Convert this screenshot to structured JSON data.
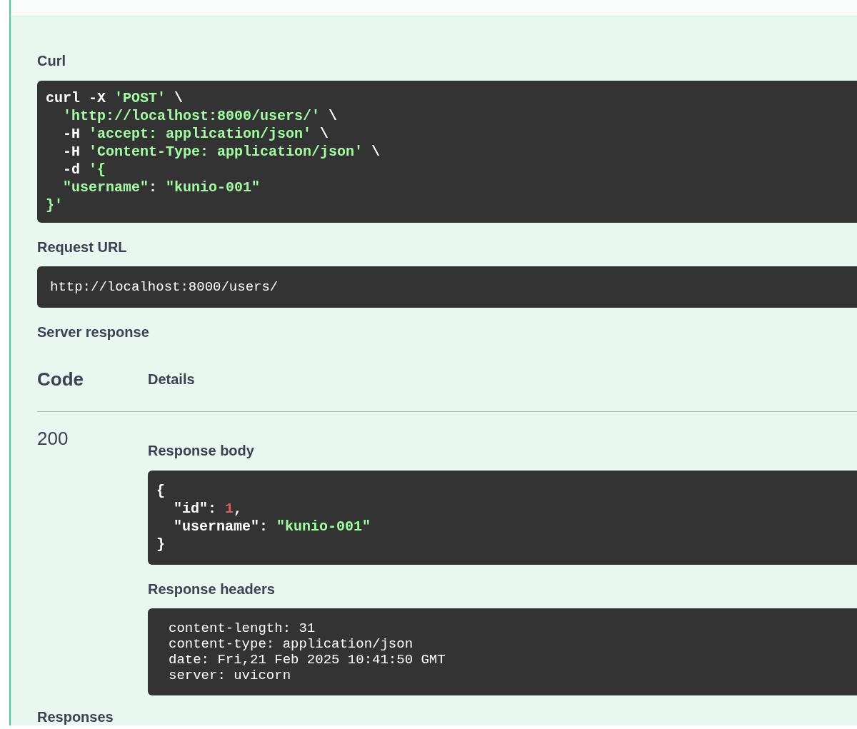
{
  "curl": {
    "label": "Curl",
    "lines": [
      [
        {
          "kind": "plain",
          "text": "curl -X "
        },
        {
          "kind": "string",
          "text": "'POST'"
        },
        {
          "kind": "plain",
          "text": " \\"
        }
      ],
      [
        {
          "kind": "string",
          "text": "  'http://localhost:8000/users/'"
        },
        {
          "kind": "plain",
          "text": " \\"
        }
      ],
      [
        {
          "kind": "plain",
          "text": "  -H "
        },
        {
          "kind": "string",
          "text": "'accept: application/json'"
        },
        {
          "kind": "plain",
          "text": " \\"
        }
      ],
      [
        {
          "kind": "plain",
          "text": "  -H "
        },
        {
          "kind": "string",
          "text": "'Content-Type: application/json'"
        },
        {
          "kind": "plain",
          "text": " \\"
        }
      ],
      [
        {
          "kind": "plain",
          "text": "  -d "
        },
        {
          "kind": "string",
          "text": "'{"
        }
      ],
      [
        {
          "kind": "string",
          "text": "  \"username\""
        },
        {
          "kind": "plain",
          "text": ": "
        },
        {
          "kind": "string",
          "text": "\"kunio-001\""
        }
      ],
      [
        {
          "kind": "string",
          "text": "}'"
        }
      ]
    ]
  },
  "request_url": {
    "label": "Request URL",
    "value": "http://localhost:8000/users/"
  },
  "server_response": {
    "label": "Server response",
    "columns": [
      "Code",
      "Details"
    ],
    "rows": [
      {
        "code": "200",
        "body_label": "Response body",
        "body_lines": [
          [
            {
              "kind": "plain",
              "text": "{"
            }
          ],
          [
            {
              "kind": "plain",
              "text": "  \"id\": "
            },
            {
              "kind": "number",
              "text": "1"
            },
            {
              "kind": "plain",
              "text": ","
            }
          ],
          [
            {
              "kind": "plain",
              "text": "  \"username\": "
            },
            {
              "kind": "string",
              "text": "\"kunio-001\""
            }
          ],
          [
            {
              "kind": "plain",
              "text": "}"
            }
          ]
        ],
        "headers_label": "Response headers",
        "headers": [
          "content-length: 31",
          "content-type: application/json",
          "date: Fri,21 Feb 2025 10:41:50 GMT",
          "server: uvicorn"
        ]
      }
    ]
  },
  "responses": {
    "label": "Responses"
  }
}
